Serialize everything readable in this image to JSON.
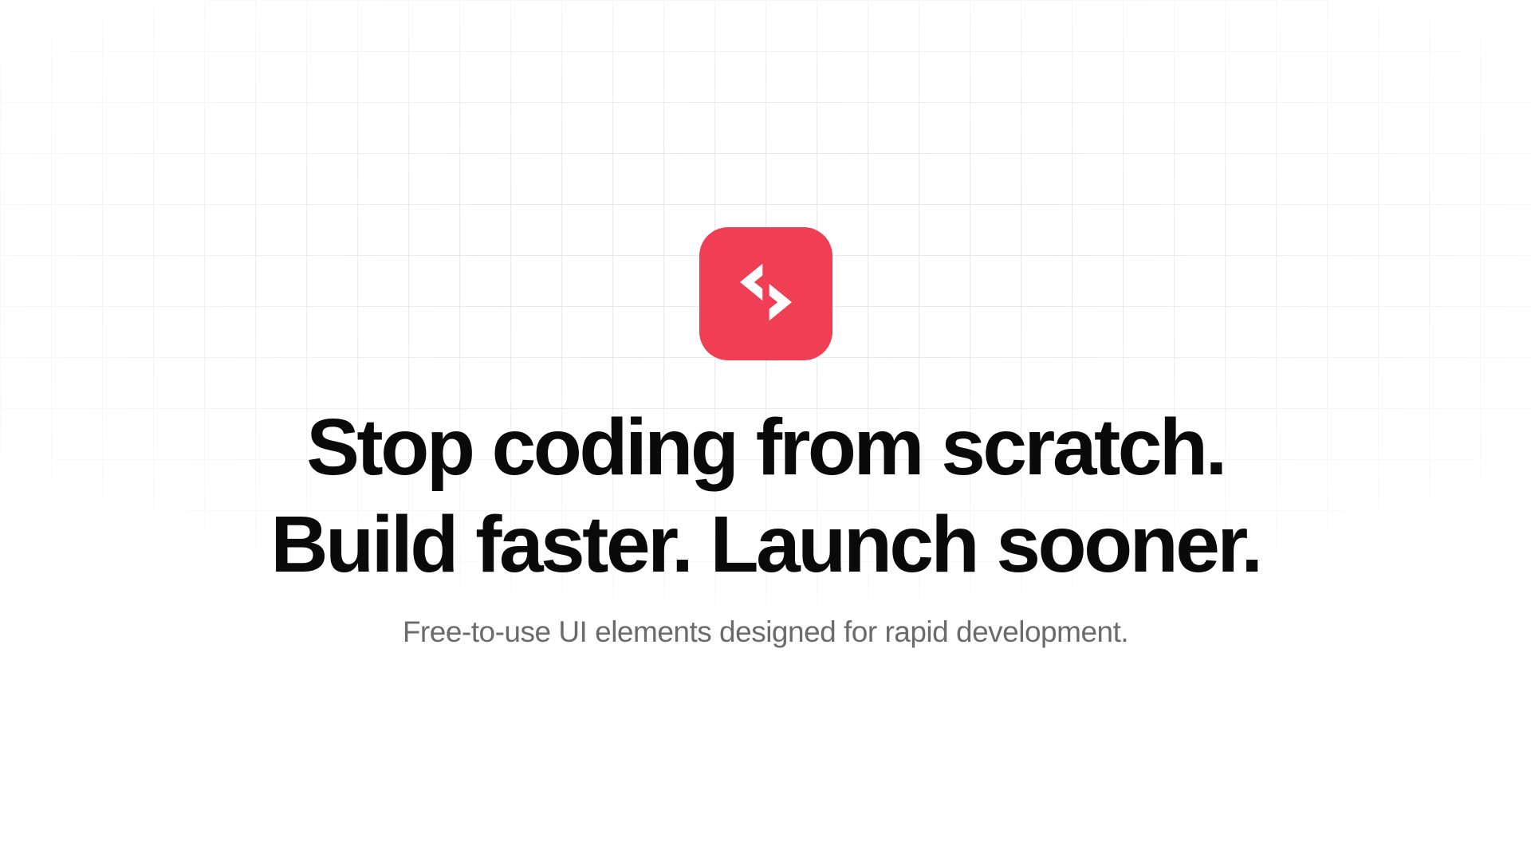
{
  "hero": {
    "headline_line1": "Stop coding from scratch.",
    "headline_line2": "Build faster. Launch sooner.",
    "subtitle": "Free-to-use UI elements designed for rapid development."
  },
  "colors": {
    "accent": "#f03e54",
    "text": "#0a0a0a",
    "muted": "#6b6b6b"
  }
}
